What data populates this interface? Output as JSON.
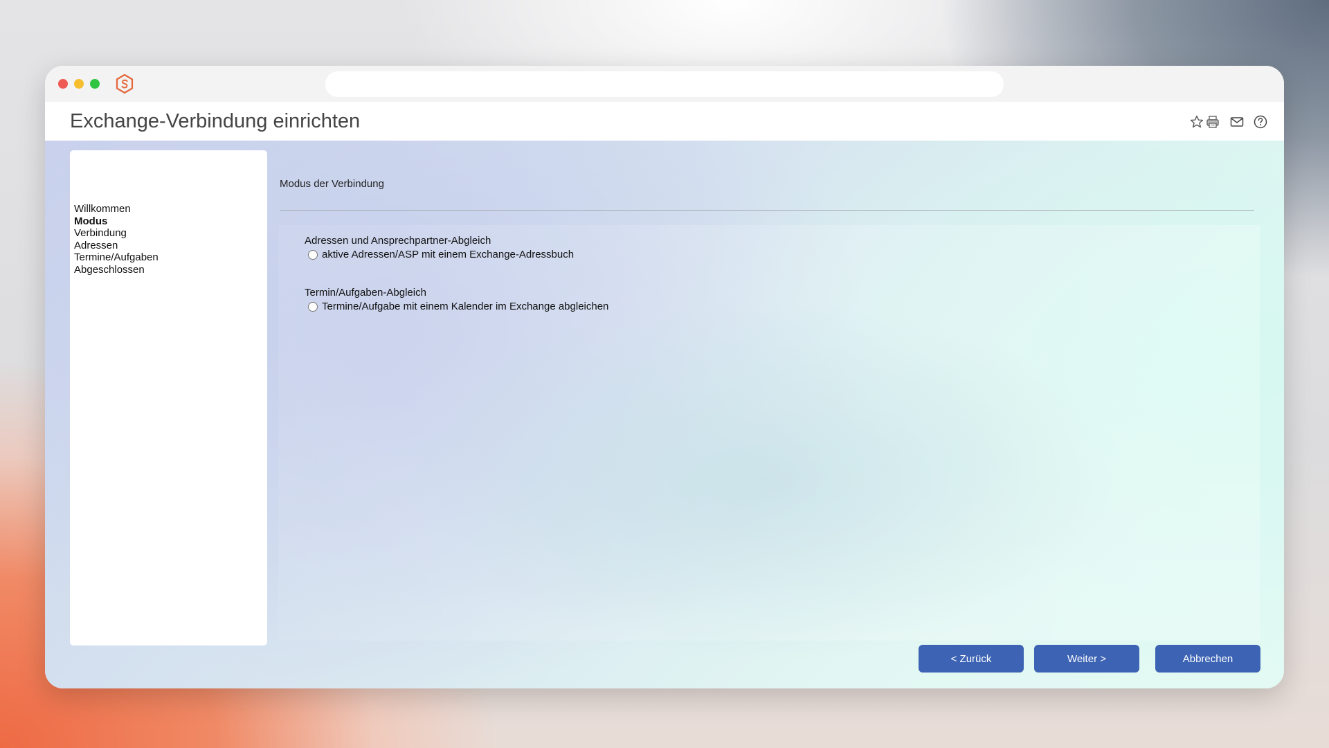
{
  "window": {
    "address_bar_value": ""
  },
  "header": {
    "title": "Exchange-Verbindung einrichten",
    "icons": [
      "star-icon",
      "printer-icon",
      "mail-icon",
      "help-icon"
    ]
  },
  "sidebar": {
    "items": [
      {
        "label": "Willkommen",
        "active": false
      },
      {
        "label": "Modus",
        "active": true
      },
      {
        "label": "Verbindung",
        "active": false
      },
      {
        "label": "Adressen",
        "active": false
      },
      {
        "label": "Termine/Aufgaben",
        "active": false
      },
      {
        "label": "Abgeschlossen",
        "active": false
      }
    ]
  },
  "main": {
    "section_title": "Modus der Verbindung",
    "groups": [
      {
        "label": "Adressen und Ansprechpartner-Abgleich",
        "option": "aktive Adressen/ASP mit einem Exchange-Adressbuch",
        "checked": false
      },
      {
        "label": "Termin/Aufgaben-Abgleich",
        "option": "Termine/Aufgabe mit einem Kalender im Exchange abgleichen",
        "checked": false
      }
    ]
  },
  "footer": {
    "back_label": "< Zurück",
    "next_label": "Weiter >",
    "cancel_label": "Abbrechen"
  },
  "colors": {
    "primary_button": "#3d63b4",
    "logo_accent": "#e5673a"
  }
}
